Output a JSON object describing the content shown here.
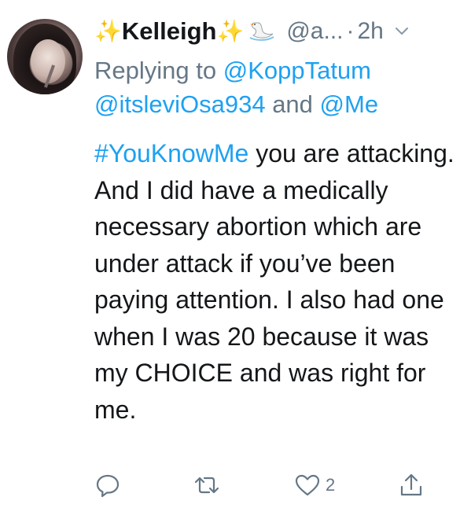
{
  "tweet": {
    "display_name": "Kelleigh",
    "name_emoji_left": "✨",
    "name_emoji_right": "✨",
    "handle": "@a...",
    "separator": "·",
    "time": "2h",
    "replying_prefix": "Replying to",
    "reply_mentions": [
      "@KoppTatum",
      "@itsleviOsa934"
    ],
    "reply_joiner": "and",
    "reply_last_mention": "@Me",
    "hashtag": "#YouKnowMe",
    "body": " you are attacking. And I did have a medically necessary abortion which are under attack if you’ve been paying attention. I also had one when I was 20 because it was my CHOICE and was right for me."
  },
  "actions": {
    "reply_icon": "reply-icon",
    "retweet_icon": "retweet-icon",
    "like_icon": "heart-icon",
    "like_count": "2",
    "share_icon": "share-icon"
  },
  "colors": {
    "link": "#1da1f2",
    "muted": "#657786",
    "text": "#14171a"
  }
}
